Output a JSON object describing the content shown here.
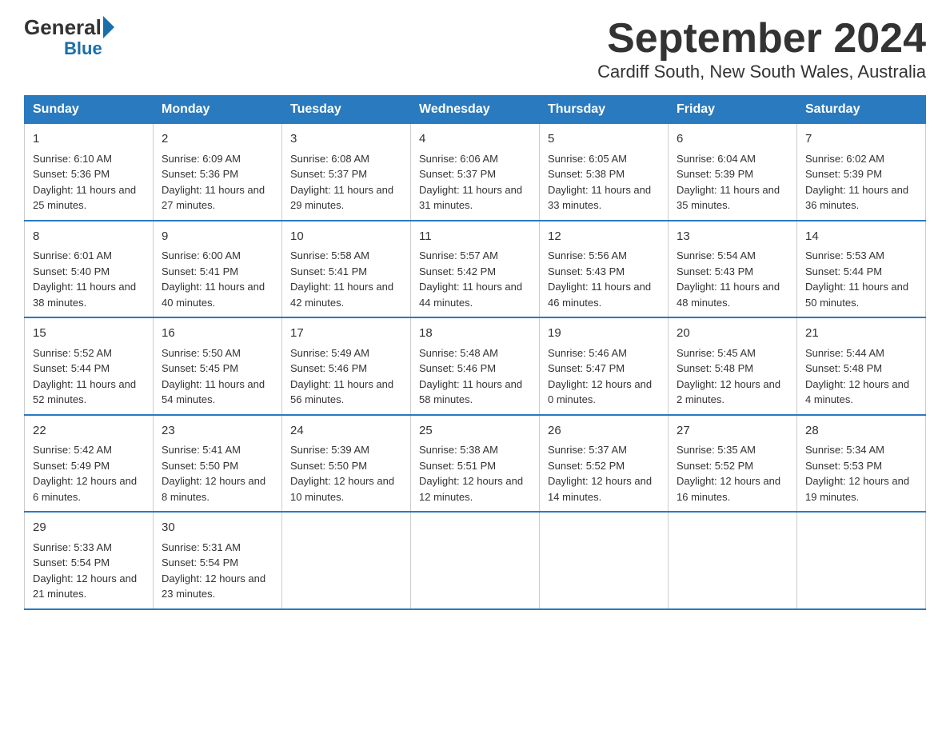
{
  "logo": {
    "general": "General",
    "blue": "Blue"
  },
  "title": {
    "month_year": "September 2024",
    "location": "Cardiff South, New South Wales, Australia"
  },
  "days_of_week": [
    "Sunday",
    "Monday",
    "Tuesday",
    "Wednesday",
    "Thursday",
    "Friday",
    "Saturday"
  ],
  "weeks": [
    [
      {
        "day": 1,
        "sunrise": "6:10 AM",
        "sunset": "5:36 PM",
        "daylight": "11 hours and 25 minutes."
      },
      {
        "day": 2,
        "sunrise": "6:09 AM",
        "sunset": "5:36 PM",
        "daylight": "11 hours and 27 minutes."
      },
      {
        "day": 3,
        "sunrise": "6:08 AM",
        "sunset": "5:37 PM",
        "daylight": "11 hours and 29 minutes."
      },
      {
        "day": 4,
        "sunrise": "6:06 AM",
        "sunset": "5:37 PM",
        "daylight": "11 hours and 31 minutes."
      },
      {
        "day": 5,
        "sunrise": "6:05 AM",
        "sunset": "5:38 PM",
        "daylight": "11 hours and 33 minutes."
      },
      {
        "day": 6,
        "sunrise": "6:04 AM",
        "sunset": "5:39 PM",
        "daylight": "11 hours and 35 minutes."
      },
      {
        "day": 7,
        "sunrise": "6:02 AM",
        "sunset": "5:39 PM",
        "daylight": "11 hours and 36 minutes."
      }
    ],
    [
      {
        "day": 8,
        "sunrise": "6:01 AM",
        "sunset": "5:40 PM",
        "daylight": "11 hours and 38 minutes."
      },
      {
        "day": 9,
        "sunrise": "6:00 AM",
        "sunset": "5:41 PM",
        "daylight": "11 hours and 40 minutes."
      },
      {
        "day": 10,
        "sunrise": "5:58 AM",
        "sunset": "5:41 PM",
        "daylight": "11 hours and 42 minutes."
      },
      {
        "day": 11,
        "sunrise": "5:57 AM",
        "sunset": "5:42 PM",
        "daylight": "11 hours and 44 minutes."
      },
      {
        "day": 12,
        "sunrise": "5:56 AM",
        "sunset": "5:43 PM",
        "daylight": "11 hours and 46 minutes."
      },
      {
        "day": 13,
        "sunrise": "5:54 AM",
        "sunset": "5:43 PM",
        "daylight": "11 hours and 48 minutes."
      },
      {
        "day": 14,
        "sunrise": "5:53 AM",
        "sunset": "5:44 PM",
        "daylight": "11 hours and 50 minutes."
      }
    ],
    [
      {
        "day": 15,
        "sunrise": "5:52 AM",
        "sunset": "5:44 PM",
        "daylight": "11 hours and 52 minutes."
      },
      {
        "day": 16,
        "sunrise": "5:50 AM",
        "sunset": "5:45 PM",
        "daylight": "11 hours and 54 minutes."
      },
      {
        "day": 17,
        "sunrise": "5:49 AM",
        "sunset": "5:46 PM",
        "daylight": "11 hours and 56 minutes."
      },
      {
        "day": 18,
        "sunrise": "5:48 AM",
        "sunset": "5:46 PM",
        "daylight": "11 hours and 58 minutes."
      },
      {
        "day": 19,
        "sunrise": "5:46 AM",
        "sunset": "5:47 PM",
        "daylight": "12 hours and 0 minutes."
      },
      {
        "day": 20,
        "sunrise": "5:45 AM",
        "sunset": "5:48 PM",
        "daylight": "12 hours and 2 minutes."
      },
      {
        "day": 21,
        "sunrise": "5:44 AM",
        "sunset": "5:48 PM",
        "daylight": "12 hours and 4 minutes."
      }
    ],
    [
      {
        "day": 22,
        "sunrise": "5:42 AM",
        "sunset": "5:49 PM",
        "daylight": "12 hours and 6 minutes."
      },
      {
        "day": 23,
        "sunrise": "5:41 AM",
        "sunset": "5:50 PM",
        "daylight": "12 hours and 8 minutes."
      },
      {
        "day": 24,
        "sunrise": "5:39 AM",
        "sunset": "5:50 PM",
        "daylight": "12 hours and 10 minutes."
      },
      {
        "day": 25,
        "sunrise": "5:38 AM",
        "sunset": "5:51 PM",
        "daylight": "12 hours and 12 minutes."
      },
      {
        "day": 26,
        "sunrise": "5:37 AM",
        "sunset": "5:52 PM",
        "daylight": "12 hours and 14 minutes."
      },
      {
        "day": 27,
        "sunrise": "5:35 AM",
        "sunset": "5:52 PM",
        "daylight": "12 hours and 16 minutes."
      },
      {
        "day": 28,
        "sunrise": "5:34 AM",
        "sunset": "5:53 PM",
        "daylight": "12 hours and 19 minutes."
      }
    ],
    [
      {
        "day": 29,
        "sunrise": "5:33 AM",
        "sunset": "5:54 PM",
        "daylight": "12 hours and 21 minutes."
      },
      {
        "day": 30,
        "sunrise": "5:31 AM",
        "sunset": "5:54 PM",
        "daylight": "12 hours and 23 minutes."
      },
      null,
      null,
      null,
      null,
      null
    ]
  ]
}
